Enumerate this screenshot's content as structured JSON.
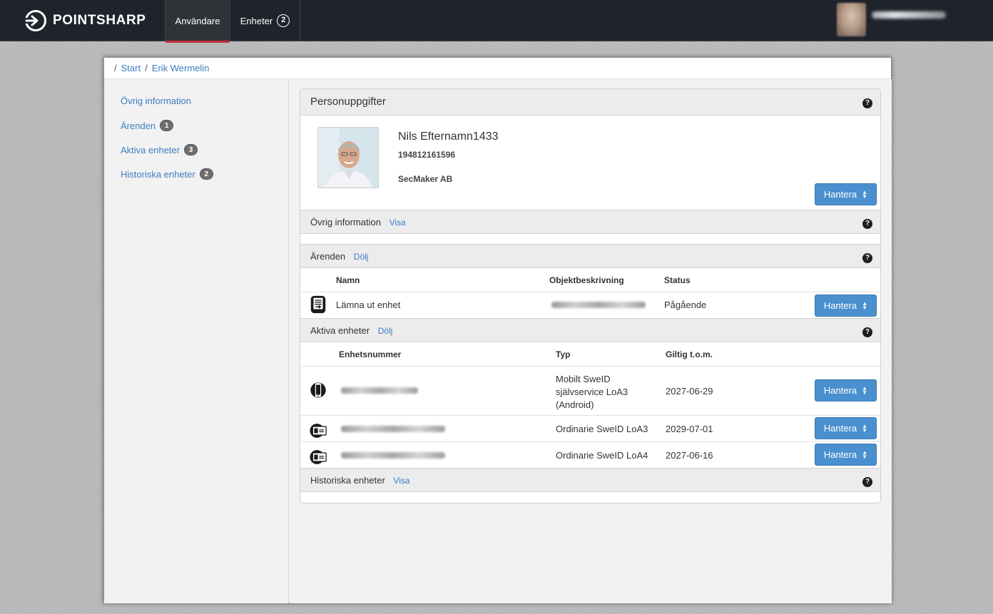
{
  "header": {
    "brand": "POINTSHARP",
    "tabs": [
      {
        "label": "Användare",
        "active": true
      },
      {
        "label": "Enheter",
        "badge": "2"
      }
    ],
    "user_icon": "user-avatar"
  },
  "breadcrumb": {
    "items": [
      "Start",
      "Erik Wermelin"
    ]
  },
  "sidebar": {
    "items": [
      {
        "label": "Övrig information"
      },
      {
        "label": "Ärenden",
        "badge": "1"
      },
      {
        "label": "Aktiva enheter",
        "badge": "3"
      },
      {
        "label": "Historiska enheter",
        "badge": "2"
      }
    ]
  },
  "person": {
    "title": "Personuppgifter",
    "name": "Nils Efternamn1433",
    "personal_number": "194812161596",
    "organization": "SecMaker AB",
    "manage_label": "Hantera"
  },
  "other_info": {
    "label": "Övrig information",
    "toggle": "Visa"
  },
  "cases": {
    "label": "Ärenden",
    "toggle": "Dölj",
    "columns": [
      "Namn",
      "Objektbeskrivning",
      "Status"
    ],
    "rows": [
      {
        "icon": "document-export-icon",
        "name": "Lämna ut enhet",
        "status": "Pågående",
        "action": "Hantera"
      }
    ]
  },
  "active_devices": {
    "label": "Aktiva enheter",
    "toggle": "Dölj",
    "columns": [
      "Enhetsnummer",
      "Typ",
      "Giltig t.o.m."
    ],
    "rows": [
      {
        "icon": "mobile-phone-icon",
        "type": "Mobilt SweID självservice LoA3 (Android)",
        "valid_until": "2027-06-29",
        "action": "Hantera"
      },
      {
        "icon": "smart-card-icon",
        "type": "Ordinarie SweID LoA3",
        "valid_until": "2029-07-01",
        "action": "Hantera"
      },
      {
        "icon": "smart-card-icon",
        "type": "Ordinarie SweID LoA4",
        "valid_until": "2027-06-16",
        "action": "Hantera"
      }
    ]
  },
  "historical_devices": {
    "label": "Historiska enheter",
    "toggle": "Visa"
  },
  "help_icon": "?",
  "colors": {
    "navbar": "#1f232b",
    "active_tab_underline": "#c0303a",
    "link": "#3c7dc0",
    "button": "#4a90cf"
  }
}
